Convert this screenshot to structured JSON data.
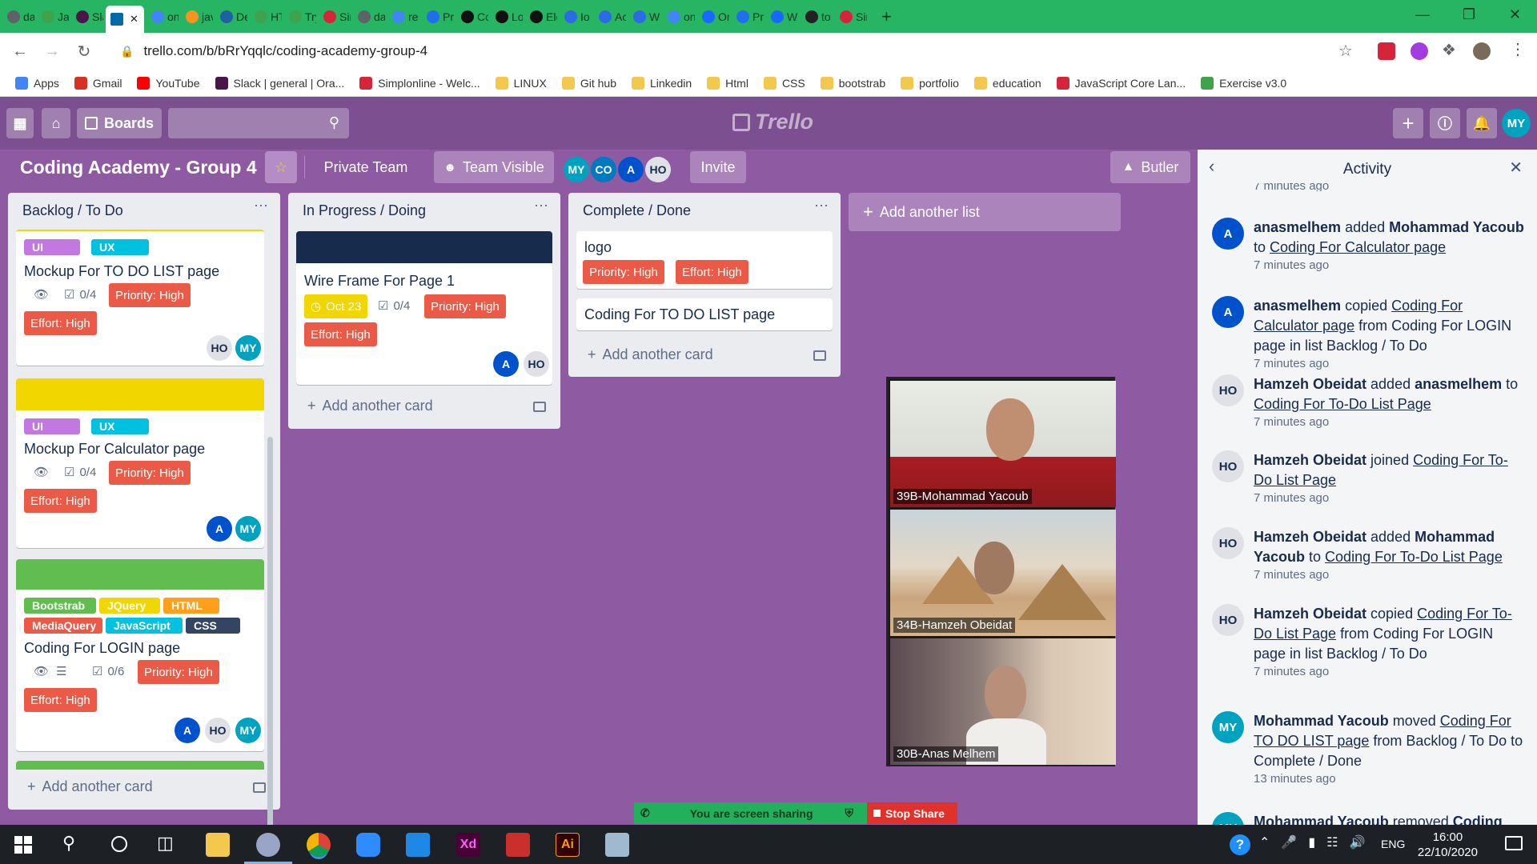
{
  "browser": {
    "tabs": [
      {
        "label": "da",
        "icon": "chrome-icon",
        "color": "#5f6368"
      },
      {
        "label": "Ja",
        "icon": "exercism-icon",
        "color": "#3fa34d"
      },
      {
        "label": "Sla",
        "icon": "slack-icon",
        "color": "#4a154b"
      },
      {
        "label": "",
        "icon": "trello-icon",
        "color": "#026aa7"
      },
      {
        "label": "on",
        "icon": "google-icon",
        "color": "#4285f4"
      },
      {
        "label": "jav",
        "icon": "w3-icon",
        "color": "#f7931e"
      },
      {
        "label": "De",
        "icon": "edraak-icon",
        "color": "#1f5fa6"
      },
      {
        "label": "HT",
        "icon": "exercism-icon",
        "color": "#3fa34d"
      },
      {
        "label": "Try",
        "icon": "exercism-icon",
        "color": "#3fa34d"
      },
      {
        "label": "Sir",
        "icon": "simplonline-icon",
        "color": "#d6243a"
      },
      {
        "label": "da",
        "icon": "chrome-icon",
        "color": "#5f6368"
      },
      {
        "label": "re",
        "icon": "google-icon",
        "color": "#4285f4"
      },
      {
        "label": "Pr",
        "icon": "github-icon",
        "color": "#1f6feb"
      },
      {
        "label": "Cc",
        "icon": "codepen-icon",
        "color": "#111"
      },
      {
        "label": "Lo",
        "icon": "codepen-icon",
        "color": "#111"
      },
      {
        "label": "Ele",
        "icon": "codepen-icon",
        "color": "#111"
      },
      {
        "label": "Io",
        "icon": "canva-icon",
        "color": "#2d6be4"
      },
      {
        "label": "Ac",
        "icon": "canva-icon",
        "color": "#2d6be4"
      },
      {
        "label": "W",
        "icon": "canva-icon",
        "color": "#2d6be4"
      },
      {
        "label": "on",
        "icon": "google-icon",
        "color": "#4285f4"
      },
      {
        "label": "Or",
        "icon": "behance-icon",
        "color": "#1769ff"
      },
      {
        "label": "Pr",
        "icon": "github-icon",
        "color": "#1f6feb"
      },
      {
        "label": "W",
        "icon": "behance-icon",
        "color": "#1769ff"
      },
      {
        "label": "to",
        "icon": "trello-icon",
        "color": "#222"
      },
      {
        "label": "Sir",
        "icon": "simplonline-icon",
        "color": "#d6243a"
      }
    ],
    "url": "trello.com/b/bRrYqqlc/coding-academy-group-4",
    "bookmarks": [
      {
        "label": "Apps",
        "color": "#4285f4"
      },
      {
        "label": "Gmail",
        "color": "#d93025"
      },
      {
        "label": "YouTube",
        "color": "#ff0000"
      },
      {
        "label": "Slack | general | Ora...",
        "color": "#4a154b"
      },
      {
        "label": "Simplonline - Welc...",
        "color": "#d6243a"
      },
      {
        "label": "LINUX",
        "color": "#f2c94c"
      },
      {
        "label": "Git hub",
        "color": "#f2c94c"
      },
      {
        "label": "Linkedin",
        "color": "#f2c94c"
      },
      {
        "label": "Html",
        "color": "#f2c94c"
      },
      {
        "label": "CSS",
        "color": "#f2c94c"
      },
      {
        "label": "bootstrab",
        "color": "#f2c94c"
      },
      {
        "label": "portfolio",
        "color": "#f2c94c"
      },
      {
        "label": "education",
        "color": "#f2c94c"
      },
      {
        "label": "JavaScript Core Lan...",
        "color": "#d6243a"
      },
      {
        "label": "Exercise v3.0",
        "color": "#3fa34d"
      }
    ]
  },
  "header": {
    "boards_label": "Boards",
    "logo": "Trello",
    "user_initials": "MY"
  },
  "board": {
    "title": "Coding Academy - Group 4",
    "private_team": "Private Team",
    "team_visible": "Team Visible",
    "members": [
      "MY",
      "CO",
      "A",
      "HO"
    ],
    "invite": "Invite",
    "butler": "Butler"
  },
  "lists": [
    {
      "title": "Backlog / To Do",
      "add": "Add another card",
      "cards": [
        {
          "labels": [
            "UI",
            "UX"
          ],
          "title": "Mockup For TO DO LIST page",
          "checklist": "0/4",
          "priority": "Priority: High",
          "effort": "Effort: High",
          "members": [
            "HO",
            "MY"
          ]
        },
        {
          "labels": [
            "UI",
            "UX"
          ],
          "title": "Mockup For Calculator page",
          "checklist": "0/4",
          "priority": "Priority: High",
          "effort": "Effort: High",
          "members": [
            "A",
            "MY"
          ]
        },
        {
          "labels": [
            "Bootstrab",
            "JQuery",
            "HTML",
            "MediaQuery",
            "JavaScript",
            "CSS"
          ],
          "title": "Coding For LOGIN page",
          "checklist": "0/6",
          "priority": "Priority: High",
          "effort": "Effort: High",
          "members": [
            "A",
            "HO",
            "MY"
          ]
        }
      ]
    },
    {
      "title": "In Progress / Doing",
      "add": "Add another card",
      "cards": [
        {
          "title": "Wire Frame For Page 1",
          "due": "Oct 23",
          "checklist": "0/4",
          "priority": "Priority: High",
          "effort": "Effort: High",
          "members": [
            "A",
            "HO"
          ]
        }
      ]
    },
    {
      "title": "Complete / Done",
      "add": "Add another card",
      "cards": [
        {
          "title": "logo",
          "priority": "Priority: High",
          "effort": "Effort: High"
        },
        {
          "title": "Coding For TO DO LIST page"
        }
      ]
    }
  ],
  "add_list": "Add another list",
  "activity": {
    "title": "Activity",
    "top_time": "7 minutes ago",
    "items": [
      {
        "av": "A",
        "actor": "anasmelhem",
        "t1": " added ",
        "b2": "Mohammad Yacoub",
        "t2": " to ",
        "link": "Coding For Calculator page",
        "t3": "",
        "time": "7 minutes ago"
      },
      {
        "av": "A",
        "actor": "anasmelhem",
        "t1": " copied ",
        "b2": "",
        "t2": "",
        "link": "Coding For Calculator page",
        "t3": " from Coding For LOGIN page in list Backlog / To Do",
        "time": "7 minutes ago"
      },
      {
        "av": "HO",
        "actor": "Hamzeh Obeidat",
        "t1": " added ",
        "b2": "anasmelhem",
        "t2": " to ",
        "link": "Coding For To-Do List Page",
        "t3": "",
        "time": "7 minutes ago"
      },
      {
        "av": "HO",
        "actor": "Hamzeh Obeidat",
        "t1": " joined ",
        "b2": "",
        "t2": "",
        "link": "Coding For To-Do List Page",
        "t3": "",
        "time": "7 minutes ago"
      },
      {
        "av": "HO",
        "actor": "Hamzeh Obeidat",
        "t1": " added ",
        "b2": "Mohammad Yacoub",
        "t2": " to ",
        "link": "Coding For To-Do List Page",
        "t3": "",
        "time": "7 minutes ago"
      },
      {
        "av": "HO",
        "actor": "Hamzeh Obeidat",
        "t1": " copied ",
        "b2": "",
        "t2": "",
        "link": "Coding For To-Do List Page",
        "t3": " from Coding For LOGIN page in list Backlog / To Do",
        "time": "7 minutes ago"
      },
      {
        "av": "MY",
        "actor": "Mohammad Yacoub",
        "t1": " moved ",
        "b2": "",
        "t2": "",
        "link": "Coding For TO DO LIST page",
        "t3": " from Backlog / To Do to Complete / Done",
        "time": "13 minutes ago"
      },
      {
        "av": "MY",
        "actor": "Mohammad Yacoub",
        "t1": " removed ",
        "b2": "Coding",
        "t2": "",
        "link": "",
        "t3": "",
        "time": ""
      }
    ]
  },
  "video": {
    "participants": [
      "39B-Mohammad Yacoub",
      "34B-Hamzeh Obeidat",
      "30B-Anas Melhem"
    ]
  },
  "sharing": {
    "message": "You are screen sharing",
    "stop": "Stop Share"
  },
  "taskbar": {
    "time": "16:00",
    "date": "22/10/2020",
    "lang": "ENG"
  },
  "colors": {
    "board_bg": "#8e5ba3",
    "header": "#7c4f90",
    "label_red": "#eb5a46",
    "label_purple": "#c377e0",
    "label_sky": "#00c2e0",
    "label_green": "#61bd4f",
    "label_yellow": "#f2d600",
    "label_orange": "#ff9f1a",
    "label_navy": "#344563",
    "avatar_teal": "#00a3bf",
    "avatar_blue": "#0052cc",
    "tab_green": "#27b463"
  }
}
